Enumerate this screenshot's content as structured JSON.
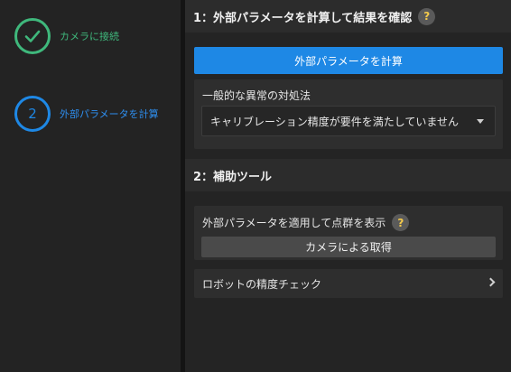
{
  "steps": [
    {
      "label": "カメラに接続",
      "state": "completed",
      "color": "#3fb87c"
    },
    {
      "number": "2",
      "label": "外部パラメータを計算",
      "state": "active",
      "color": "#1e88e5"
    }
  ],
  "section1": {
    "title": "1：外部パラメータを計算して結果を確認",
    "help_icon": "?",
    "primary_button": "外部パラメータを計算",
    "troubleshoot": {
      "title": "一般的な異常の対処法",
      "selected_option": "キャリブレーション精度が要件を満たしていません"
    }
  },
  "section2": {
    "title": "2：補助ツール",
    "pointcloud": {
      "title": "外部パラメータを適用して点群を表示",
      "help_icon": "?",
      "button": "カメラによる取得"
    },
    "robot_check": {
      "label": "ロボットの精度チェック"
    }
  },
  "colors": {
    "accent": "#1e88e5",
    "success": "#3fb87c",
    "help_icon_glyph": "#f2c94c"
  }
}
